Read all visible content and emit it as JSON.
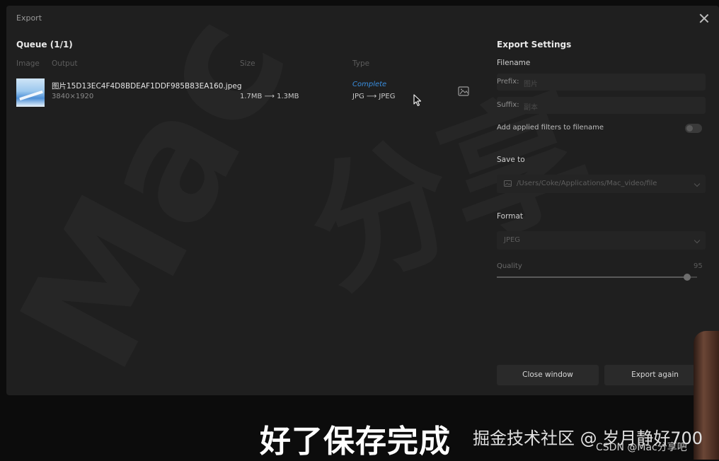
{
  "window": {
    "title": "Export"
  },
  "queue": {
    "title": "Queue (1/1)",
    "columns": {
      "image": "Image",
      "output": "Output",
      "size": "Size",
      "type": "Type"
    },
    "items": [
      {
        "filename": "图片15D13EC4F4D8BDEAF1DDF985B83EA160.jpeg",
        "dimensions": "3840×1920",
        "size": "1.7MB ⟶ 1.3MB",
        "status": "Complete",
        "type": "JPG ⟶ JPEG"
      }
    ]
  },
  "settings": {
    "title": "Export Settings",
    "filename_label": "Filename",
    "prefix_label": "Prefix:",
    "prefix_placeholder": "图片",
    "suffix_label": "Suffix:",
    "suffix_placeholder": "副本",
    "applied_filters_label": "Add applied filters to filename",
    "applied_filters_on": false,
    "save_to_label": "Save to",
    "save_path": "/Users/Coke/Applications/Mac_video/file",
    "format_label": "Format",
    "format_value": "JPEG",
    "quality_label": "Quality",
    "quality_value": "95",
    "quality_fraction": 0.95
  },
  "buttons": {
    "close": "Close window",
    "export_again": "Export again"
  },
  "overlay": {
    "subtitle": "好了保存完成",
    "source": "掘金技术社区 @ 岁月静好700",
    "csdn": "CSDN @Mac分享吧"
  },
  "colors": {
    "window_bg": "#1f1f1f",
    "status_blue": "#3a8fe0",
    "button_bg": "#2a2a2a"
  }
}
